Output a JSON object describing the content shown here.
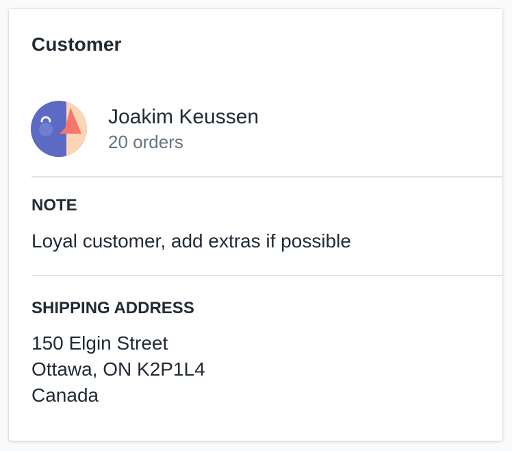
{
  "card": {
    "title": "Customer"
  },
  "customer": {
    "name": "Joakim Keussen",
    "orders": "20 orders",
    "avatar_icon": "customer-avatar-icon"
  },
  "note": {
    "heading": "NOTE",
    "text": "Loyal customer, add extras if possible"
  },
  "shipping": {
    "heading": "SHIPPING ADDRESS",
    "lines": [
      "150 Elgin Street",
      "Ottawa, ON K2P1L4",
      "Canada"
    ]
  },
  "colors": {
    "text": "#212b36",
    "subdued": "#637381",
    "divider": "#dfe3e8",
    "avatar_bg": "#5c6ac4",
    "avatar_accent": "#fdd4b5",
    "avatar_nose": "#f49342"
  }
}
